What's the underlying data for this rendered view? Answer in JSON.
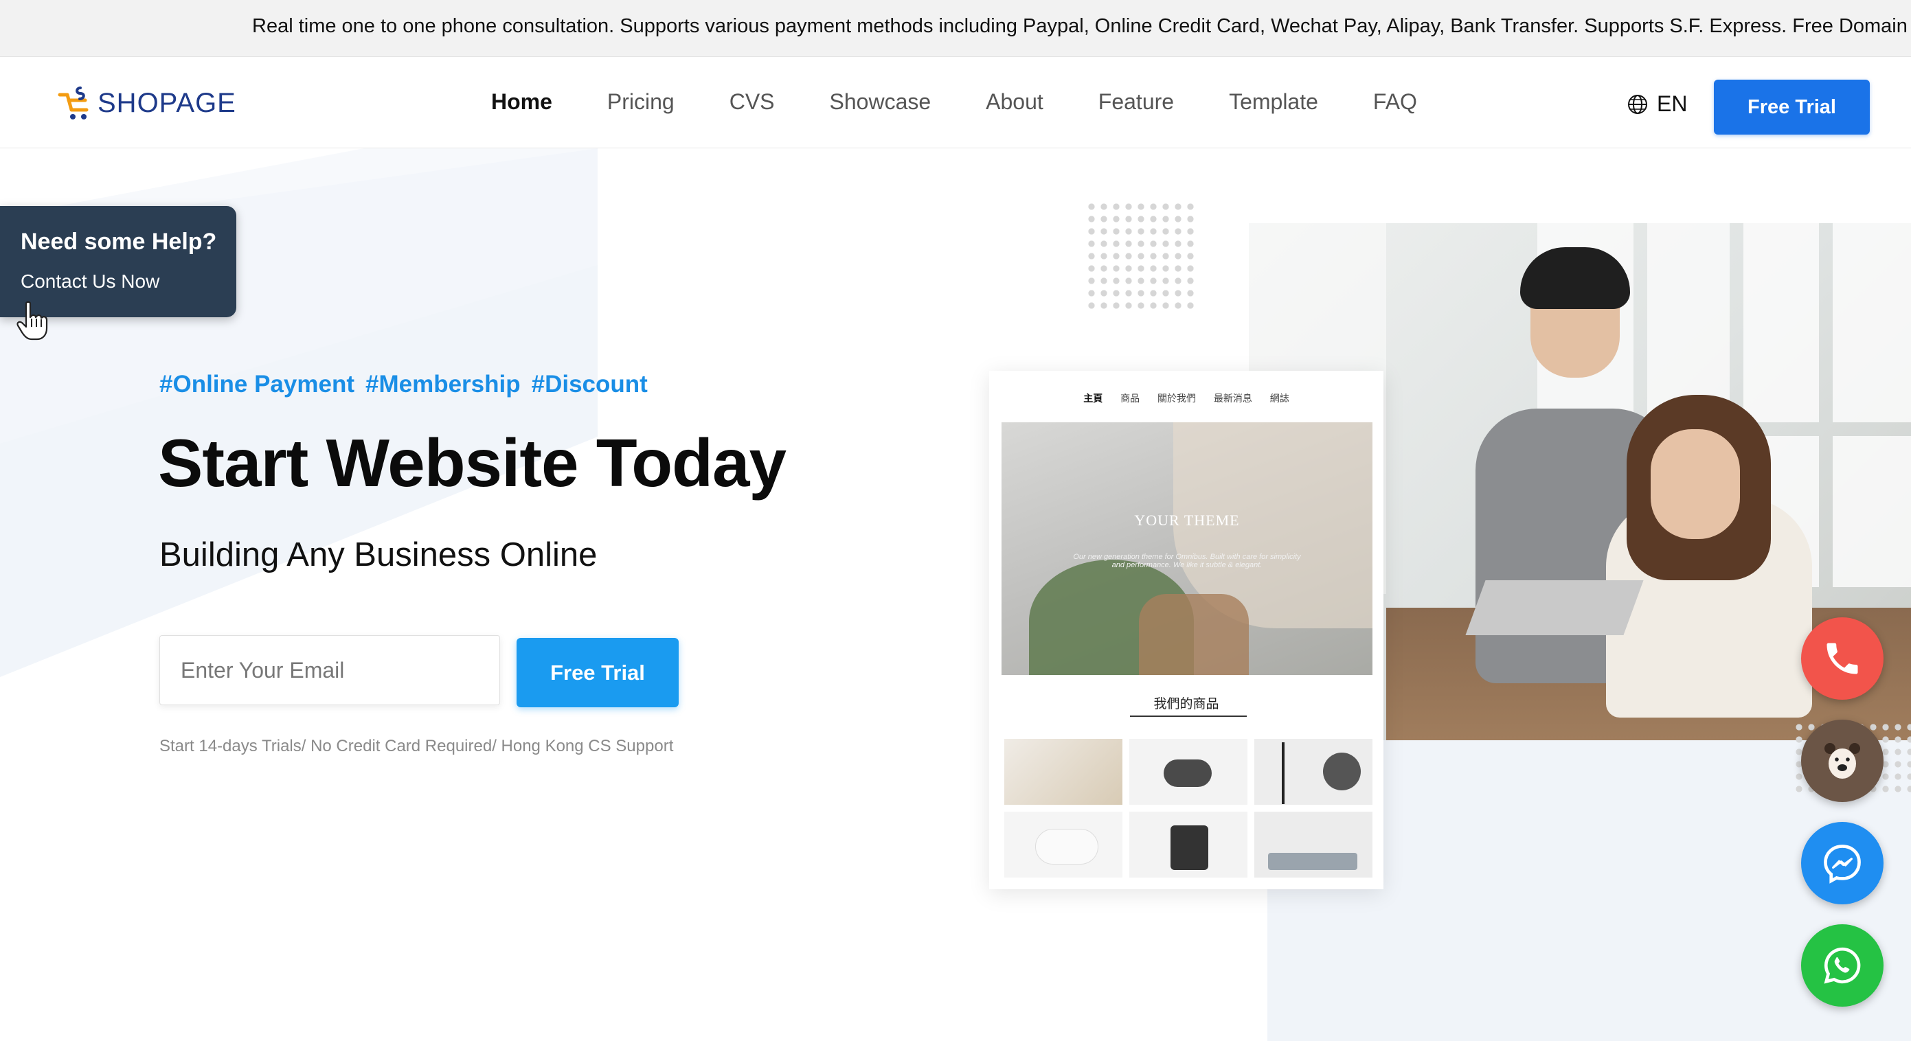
{
  "announcement": "Real time one to one phone consultation. Supports various payment methods including Paypal, Online Credit Card, Wechat Pay, Alipay, Bank Transfer. Supports S.F. Express. Free Domain w",
  "brand": {
    "name": "SHOPAGE",
    "logo_icon": "cart-icon"
  },
  "nav": {
    "items": [
      "Home",
      "Pricing",
      "CVS",
      "Showcase",
      "About",
      "Feature",
      "Template",
      "FAQ"
    ],
    "active": "Home"
  },
  "language": {
    "icon": "globe-icon",
    "label": "EN"
  },
  "header_cta": "Free Trial",
  "help": {
    "title": "Need some Help?",
    "subtitle": "Contact Us Now"
  },
  "hero": {
    "tags": [
      "#Online Payment",
      "#Membership",
      "#Discount"
    ],
    "title": "Start Website Today",
    "subtitle": "Building Any Business Online",
    "email_placeholder": "Enter Your Email",
    "cta": "Free Trial",
    "note": "Start 14-days Trials/ No Credit Card Required/ Hong Kong CS Support"
  },
  "mockup": {
    "nav": [
      "主頁",
      "商品",
      "關於我們",
      "最新消息",
      "網誌"
    ],
    "hero_title": "YOUR THEME",
    "hero_text": "Our new generation theme for Omnibus. Built with care for simplicity and performance. We like it subtle & elegant.",
    "section_title": "我們的商品"
  },
  "floating_buttons": [
    {
      "name": "phone-icon",
      "color": "#f2544b"
    },
    {
      "name": "line-bear-icon",
      "color": "#6b5546"
    },
    {
      "name": "messenger-icon",
      "color": "#1f8ef1"
    },
    {
      "name": "whatsapp-icon",
      "color": "#25c244"
    }
  ],
  "colors": {
    "primary": "#1a73e8",
    "accent": "#1a9bf0",
    "tag": "#1a8ee6",
    "help_bg": "#2b3e53"
  }
}
